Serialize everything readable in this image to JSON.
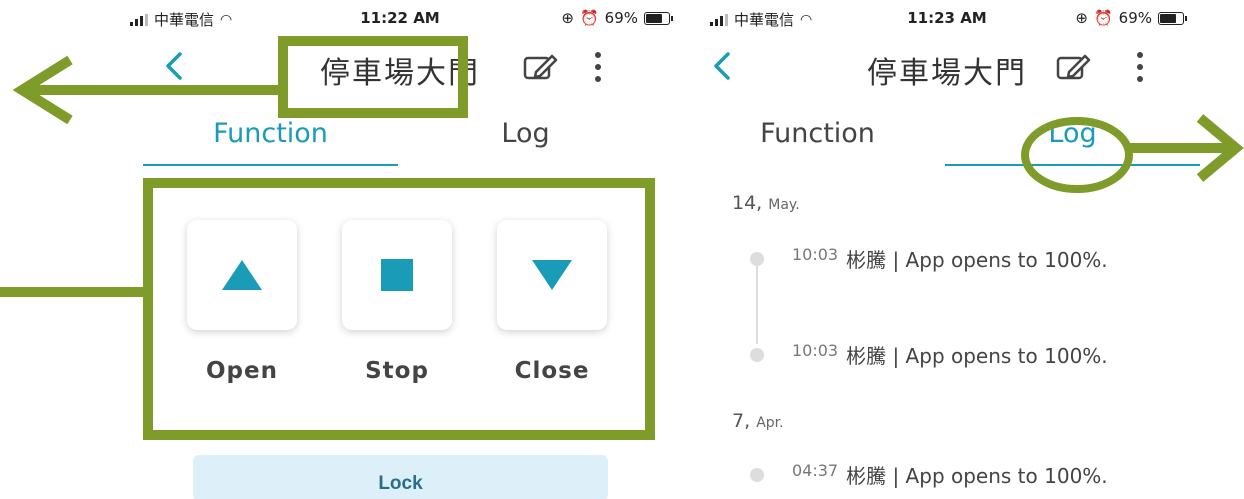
{
  "screens": [
    {
      "status": {
        "carrier": "中華電信",
        "time": "11:22 AM",
        "battery": "69%"
      },
      "title": "停車場大門",
      "tabs": [
        {
          "label": "Function"
        },
        {
          "label": "Log"
        }
      ],
      "active_tab": "Function",
      "controls": [
        {
          "label": "Open",
          "icon": "up-triangle-icon"
        },
        {
          "label": "Stop",
          "icon": "stop-square-icon"
        },
        {
          "label": "Close",
          "icon": "down-triangle-icon"
        }
      ],
      "lock_label": "Lock"
    },
    {
      "status": {
        "carrier": "中華電信",
        "time": "11:23 AM",
        "battery": "69%"
      },
      "title": "停車場大門",
      "tabs": [
        {
          "label": "Function"
        },
        {
          "label": "Log"
        }
      ],
      "active_tab": "Log",
      "log_groups": [
        {
          "day": "14,",
          "month": "May.",
          "entries": [
            {
              "time": "10:03",
              "text": "彬騰 | App opens to 100%."
            },
            {
              "time": "10:03",
              "text": "彬騰 | App opens to 100%."
            }
          ]
        },
        {
          "day": "7,",
          "month": "Apr.",
          "entries": [
            {
              "time": "04:37",
              "text": "彬騰 | App opens to 100%."
            }
          ]
        }
      ]
    }
  ],
  "annotation_color": "#7f9c2b",
  "accent_color": "#1a9bb8"
}
